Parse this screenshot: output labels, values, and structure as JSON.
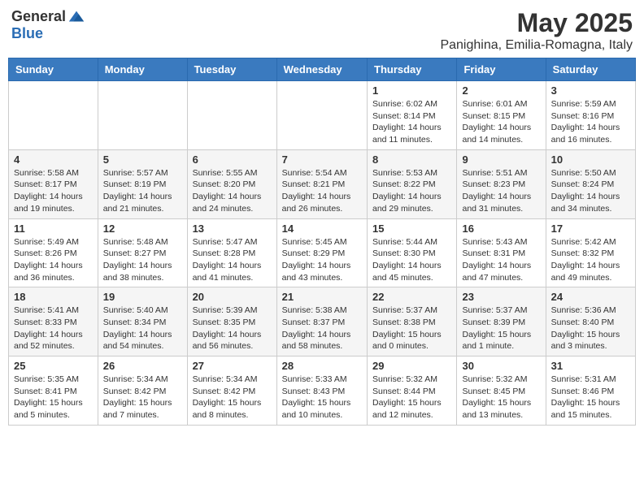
{
  "header": {
    "logo_general": "General",
    "logo_blue": "Blue",
    "main_title": "May 2025",
    "subtitle": "Panighina, Emilia-Romagna, Italy"
  },
  "weekdays": [
    "Sunday",
    "Monday",
    "Tuesday",
    "Wednesday",
    "Thursday",
    "Friday",
    "Saturday"
  ],
  "weeks": [
    [
      {
        "day": "",
        "sunrise": "",
        "sunset": "",
        "daylight": ""
      },
      {
        "day": "",
        "sunrise": "",
        "sunset": "",
        "daylight": ""
      },
      {
        "day": "",
        "sunrise": "",
        "sunset": "",
        "daylight": ""
      },
      {
        "day": "",
        "sunrise": "",
        "sunset": "",
        "daylight": ""
      },
      {
        "day": "1",
        "sunrise": "Sunrise: 6:02 AM",
        "sunset": "Sunset: 8:14 PM",
        "daylight": "Daylight: 14 hours and 11 minutes."
      },
      {
        "day": "2",
        "sunrise": "Sunrise: 6:01 AM",
        "sunset": "Sunset: 8:15 PM",
        "daylight": "Daylight: 14 hours and 14 minutes."
      },
      {
        "day": "3",
        "sunrise": "Sunrise: 5:59 AM",
        "sunset": "Sunset: 8:16 PM",
        "daylight": "Daylight: 14 hours and 16 minutes."
      }
    ],
    [
      {
        "day": "4",
        "sunrise": "Sunrise: 5:58 AM",
        "sunset": "Sunset: 8:17 PM",
        "daylight": "Daylight: 14 hours and 19 minutes."
      },
      {
        "day": "5",
        "sunrise": "Sunrise: 5:57 AM",
        "sunset": "Sunset: 8:19 PM",
        "daylight": "Daylight: 14 hours and 21 minutes."
      },
      {
        "day": "6",
        "sunrise": "Sunrise: 5:55 AM",
        "sunset": "Sunset: 8:20 PM",
        "daylight": "Daylight: 14 hours and 24 minutes."
      },
      {
        "day": "7",
        "sunrise": "Sunrise: 5:54 AM",
        "sunset": "Sunset: 8:21 PM",
        "daylight": "Daylight: 14 hours and 26 minutes."
      },
      {
        "day": "8",
        "sunrise": "Sunrise: 5:53 AM",
        "sunset": "Sunset: 8:22 PM",
        "daylight": "Daylight: 14 hours and 29 minutes."
      },
      {
        "day": "9",
        "sunrise": "Sunrise: 5:51 AM",
        "sunset": "Sunset: 8:23 PM",
        "daylight": "Daylight: 14 hours and 31 minutes."
      },
      {
        "day": "10",
        "sunrise": "Sunrise: 5:50 AM",
        "sunset": "Sunset: 8:24 PM",
        "daylight": "Daylight: 14 hours and 34 minutes."
      }
    ],
    [
      {
        "day": "11",
        "sunrise": "Sunrise: 5:49 AM",
        "sunset": "Sunset: 8:26 PM",
        "daylight": "Daylight: 14 hours and 36 minutes."
      },
      {
        "day": "12",
        "sunrise": "Sunrise: 5:48 AM",
        "sunset": "Sunset: 8:27 PM",
        "daylight": "Daylight: 14 hours and 38 minutes."
      },
      {
        "day": "13",
        "sunrise": "Sunrise: 5:47 AM",
        "sunset": "Sunset: 8:28 PM",
        "daylight": "Daylight: 14 hours and 41 minutes."
      },
      {
        "day": "14",
        "sunrise": "Sunrise: 5:45 AM",
        "sunset": "Sunset: 8:29 PM",
        "daylight": "Daylight: 14 hours and 43 minutes."
      },
      {
        "day": "15",
        "sunrise": "Sunrise: 5:44 AM",
        "sunset": "Sunset: 8:30 PM",
        "daylight": "Daylight: 14 hours and 45 minutes."
      },
      {
        "day": "16",
        "sunrise": "Sunrise: 5:43 AM",
        "sunset": "Sunset: 8:31 PM",
        "daylight": "Daylight: 14 hours and 47 minutes."
      },
      {
        "day": "17",
        "sunrise": "Sunrise: 5:42 AM",
        "sunset": "Sunset: 8:32 PM",
        "daylight": "Daylight: 14 hours and 49 minutes."
      }
    ],
    [
      {
        "day": "18",
        "sunrise": "Sunrise: 5:41 AM",
        "sunset": "Sunset: 8:33 PM",
        "daylight": "Daylight: 14 hours and 52 minutes."
      },
      {
        "day": "19",
        "sunrise": "Sunrise: 5:40 AM",
        "sunset": "Sunset: 8:34 PM",
        "daylight": "Daylight: 14 hours and 54 minutes."
      },
      {
        "day": "20",
        "sunrise": "Sunrise: 5:39 AM",
        "sunset": "Sunset: 8:35 PM",
        "daylight": "Daylight: 14 hours and 56 minutes."
      },
      {
        "day": "21",
        "sunrise": "Sunrise: 5:38 AM",
        "sunset": "Sunset: 8:37 PM",
        "daylight": "Daylight: 14 hours and 58 minutes."
      },
      {
        "day": "22",
        "sunrise": "Sunrise: 5:37 AM",
        "sunset": "Sunset: 8:38 PM",
        "daylight": "Daylight: 15 hours and 0 minutes."
      },
      {
        "day": "23",
        "sunrise": "Sunrise: 5:37 AM",
        "sunset": "Sunset: 8:39 PM",
        "daylight": "Daylight: 15 hours and 1 minute."
      },
      {
        "day": "24",
        "sunrise": "Sunrise: 5:36 AM",
        "sunset": "Sunset: 8:40 PM",
        "daylight": "Daylight: 15 hours and 3 minutes."
      }
    ],
    [
      {
        "day": "25",
        "sunrise": "Sunrise: 5:35 AM",
        "sunset": "Sunset: 8:41 PM",
        "daylight": "Daylight: 15 hours and 5 minutes."
      },
      {
        "day": "26",
        "sunrise": "Sunrise: 5:34 AM",
        "sunset": "Sunset: 8:42 PM",
        "daylight": "Daylight: 15 hours and 7 minutes."
      },
      {
        "day": "27",
        "sunrise": "Sunrise: 5:34 AM",
        "sunset": "Sunset: 8:42 PM",
        "daylight": "Daylight: 15 hours and 8 minutes."
      },
      {
        "day": "28",
        "sunrise": "Sunrise: 5:33 AM",
        "sunset": "Sunset: 8:43 PM",
        "daylight": "Daylight: 15 hours and 10 minutes."
      },
      {
        "day": "29",
        "sunrise": "Sunrise: 5:32 AM",
        "sunset": "Sunset: 8:44 PM",
        "daylight": "Daylight: 15 hours and 12 minutes."
      },
      {
        "day": "30",
        "sunrise": "Sunrise: 5:32 AM",
        "sunset": "Sunset: 8:45 PM",
        "daylight": "Daylight: 15 hours and 13 minutes."
      },
      {
        "day": "31",
        "sunrise": "Sunrise: 5:31 AM",
        "sunset": "Sunset: 8:46 PM",
        "daylight": "Daylight: 15 hours and 15 minutes."
      }
    ]
  ]
}
